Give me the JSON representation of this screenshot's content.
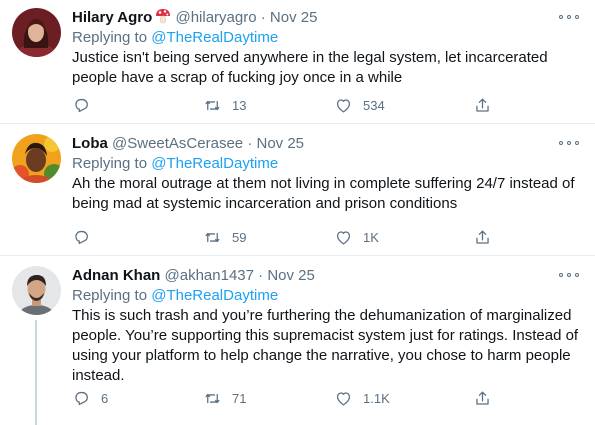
{
  "tweets": [
    {
      "name": "Hilary Agro",
      "name_emoji": "mushroom-emoji",
      "handle": "@hilaryagro",
      "dot": "·",
      "date": "Nov 25",
      "reply_prefix": "Replying to ",
      "reply_to": "@TheRealDaytime",
      "text": "Justice isn't being served anywhere in the legal system, let incarcerated people have a scrap of fucking joy once in a while",
      "replies": "",
      "retweets": "13",
      "likes": "534"
    },
    {
      "name": "Loba",
      "handle": "@SweetAsCerasee",
      "dot": "·",
      "date": "Nov 25",
      "reply_prefix": "Replying to ",
      "reply_to": "@TheRealDaytime",
      "text": "Ah the moral outrage at them not living in complete suffering 24/7 instead of being mad at systemic incarceration and prison conditions",
      "replies": "",
      "retweets": "59",
      "likes": "1K"
    },
    {
      "name": "Adnan Khan",
      "handle": "@akhan1437",
      "dot": "·",
      "date": "Nov 25",
      "reply_prefix": "Replying to ",
      "reply_to": "@TheRealDaytime",
      "text": "This is such trash and you’re furthering the dehumanization of marginalized people. You’re supporting this supremacist system just for ratings. Instead of using your platform to help change the narrative, you chose to harm people instead.",
      "replies": "6",
      "retweets": "71",
      "likes": "1.1K"
    }
  ],
  "colors": {
    "link": "#1da1f2",
    "muted": "#5b7083",
    "divider": "#e6ecf0"
  }
}
